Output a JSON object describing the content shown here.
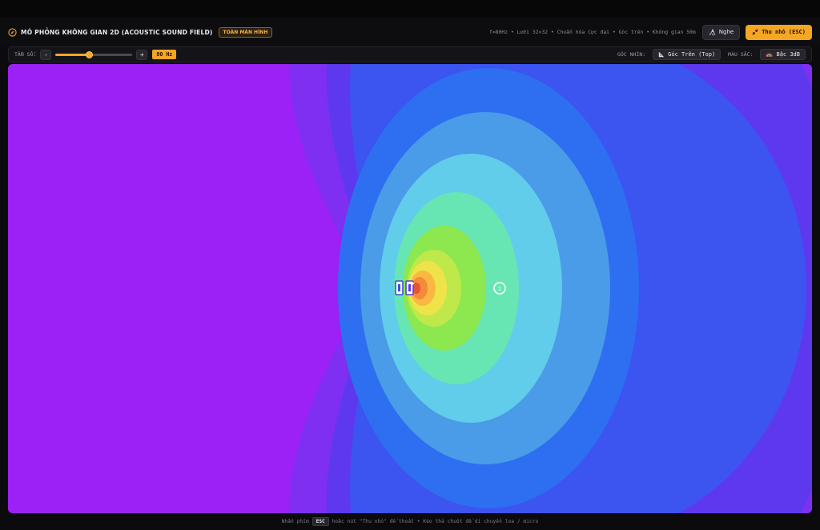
{
  "header": {
    "title": "MÔ PHỎNG KHÔNG GIAN 2D (ACOUSTIC SOUND FIELD)",
    "fullscreen_badge": "TOÀN MÀN HÌNH",
    "info": "f=80Hz • Lưới 32×32 • Chuẩn hóa Cực đại • Góc trên • Không gian 50m",
    "listen_label": "Nghe",
    "shrink_label": "Thu nhỏ (ESC)",
    "accent": "#f5a623"
  },
  "toolbar": {
    "freq_label": "TẦN SỐ:",
    "minus": "-",
    "plus": "+",
    "freq_value": "80 Hz",
    "slider_fraction": 0.44,
    "view_label": "GÓC NHÌN:",
    "view_value": "Góc Trên (Top)",
    "color_label": "MÀU SẮC:",
    "color_value": "Bậc 3dB"
  },
  "field": {
    "mic_label": "1",
    "bands": [
      "#9b21f6",
      "#7e2ff2",
      "#5e38ef",
      "#3c54f0",
      "#2d6ff0",
      "#4a9be8",
      "#61cdea",
      "#67e6b3",
      "#8de84f",
      "#bfe84a",
      "#efe34a",
      "#f9b842",
      "#f48a3b",
      "#e5533a"
    ]
  },
  "footer": {
    "prefix": "Nhấn phím",
    "key": "ESC",
    "suffix": "hoặc nút \"Thu nhỏ\" để thoát • Kéo thả chuột để di chuyển loa / micro"
  }
}
